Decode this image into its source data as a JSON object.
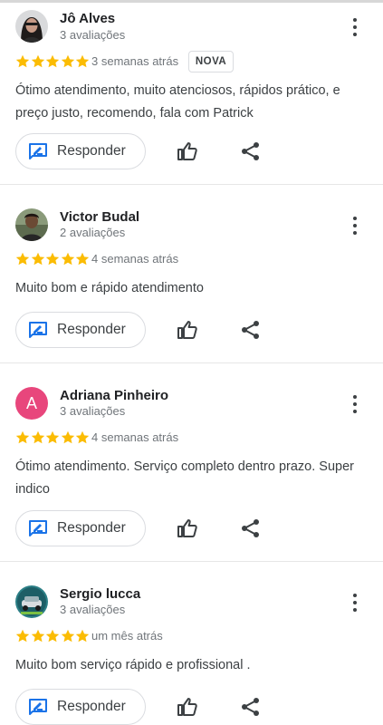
{
  "reviews": [
    {
      "name": "Jô Alves",
      "count": "3 avaliações",
      "rating": 5,
      "when": "3 semanas atrás",
      "badge": "NOVA",
      "text": "Ótimo atendimento, muito atenciosos, rápidos prático, e preço justo, recomendo, fala com Patrick",
      "reply_label": "Responder",
      "avatar": "photo-woman"
    },
    {
      "name": "Victor Budal",
      "count": "2 avaliações",
      "rating": 5,
      "when": "4 semanas atrás",
      "text": "Muito bom e rápido atendimento",
      "reply_label": "Responder",
      "avatar": "photo-man"
    },
    {
      "name": "Adriana Pinheiro",
      "count": "3 avaliações",
      "rating": 5,
      "when": "4 semanas atrás",
      "text": "Ótimo atendimento. Serviço completo dentro prazo. Super indico",
      "reply_label": "Responder",
      "avatar": "letter",
      "avatar_letter": "A",
      "avatar_color": "#e8467c"
    },
    {
      "name": "Sergio lucca",
      "count": "3 avaliações",
      "rating": 5,
      "when": "um mês atrás",
      "text": "Muito bom serviço rápido e profissional .",
      "reply_label": "Responder",
      "avatar": "photo-car"
    }
  ],
  "colors": {
    "star": "#fbbc04",
    "reply_icon": "#1a73e8",
    "text": "#3c4043",
    "muted": "#70757a"
  },
  "icons": {
    "reply": "reply-edit-icon",
    "like": "thumbs-up-icon",
    "share": "share-icon",
    "menu": "more-vert-icon",
    "star": "star-icon"
  }
}
